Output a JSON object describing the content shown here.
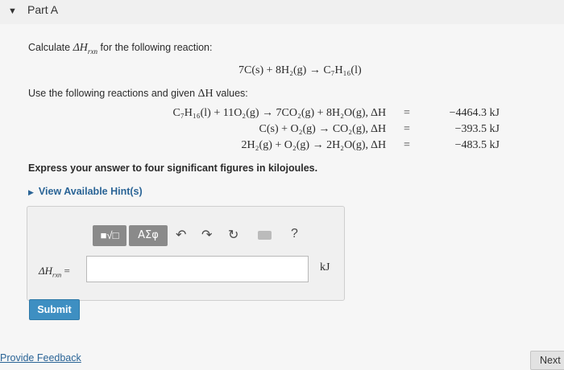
{
  "header": {
    "caret": "▼",
    "part_title": "Part A"
  },
  "question": {
    "prompt_pre": "Calculate ",
    "prompt_symbol": "ΔH",
    "prompt_sub": "rxn",
    "prompt_post": " for the following reaction:",
    "target_reaction": "7C(s) + 8H₂(g) → C₇H₁₆(l)",
    "use_text_pre": "Use the following reactions and given ",
    "use_text_symbol": "ΔH",
    "use_text_post": " values:",
    "reactions": [
      {
        "equation": "C₇H₁₆(l) + 11O₂(g) → 7CO₂(g) + 8H₂O(g),",
        "dh_label": "ΔH",
        "eq": "=",
        "value": "−4464.3 kJ"
      },
      {
        "equation": "C(s) + O₂(g) → CO₂(g),",
        "dh_label": "ΔH",
        "eq": "=",
        "value": "−393.5 kJ"
      },
      {
        "equation": "2H₂(g) + O₂(g) → 2H₂O(g),",
        "dh_label": "ΔH",
        "eq": "=",
        "value": "−483.5 kJ"
      }
    ],
    "instruction": "Express your answer to four significant figures in kilojoules.",
    "hints_label": "View Available Hint(s)"
  },
  "answer": {
    "toolbar": {
      "template_label": "■√□",
      "greek_label": "ΑΣφ",
      "undo_glyph": "↶",
      "redo_glyph": "↷",
      "reset_glyph": "↻",
      "help_glyph": "?"
    },
    "label_symbol": "ΔH",
    "label_sub": "rxn",
    "label_eq": " =",
    "input_value": "",
    "unit": "kJ"
  },
  "buttons": {
    "submit": "Submit",
    "next": "Next"
  },
  "footer": {
    "feedback_link": "Provide Feedback"
  },
  "icons": {
    "caret": "caret-down-icon",
    "undo": "undo-icon",
    "redo": "redo-icon",
    "reset": "reset-icon",
    "keyboard": "keyboard-icon",
    "help": "help-icon"
  },
  "colors": {
    "primary_button": "#3e8fc2",
    "link": "#2a6496",
    "toolbar_button": "#8a8a8a"
  }
}
